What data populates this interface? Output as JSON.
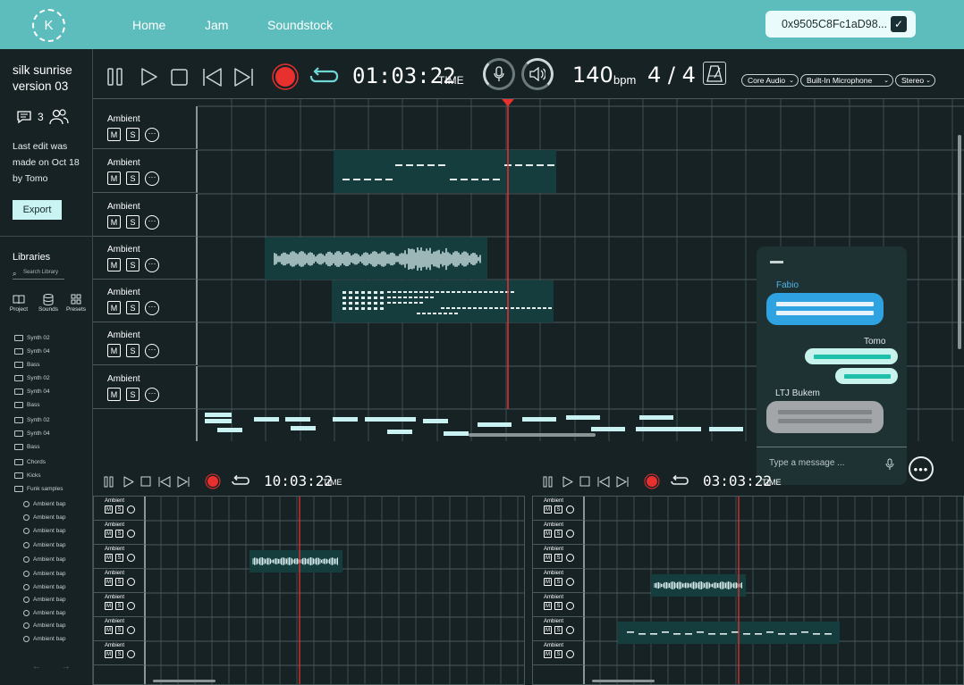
{
  "topbar": {
    "logo_letter": "K",
    "nav": [
      "Home",
      "Jam",
      "Soundstock"
    ],
    "wallet_address": "0x9505C8Fc1aD98..."
  },
  "project": {
    "title_line1": "silk sunrise",
    "title_line2": "version 03",
    "collaborators_count": "3",
    "last_edit": [
      "Last edit was",
      "made on Oct 18",
      "by Tomo"
    ],
    "export_label": "Export"
  },
  "libraries": {
    "title": "Libraries",
    "search_placeholder": "Search Library",
    "tabs": [
      "Project",
      "Sounds",
      "Presets"
    ],
    "tree": [
      {
        "label": "Synth 02",
        "type": "folder"
      },
      {
        "label": "Synth 04",
        "type": "folder"
      },
      {
        "label": "Bass",
        "type": "folder"
      },
      {
        "label": "Synth 02",
        "type": "folder"
      },
      {
        "label": "Synth 04",
        "type": "folder"
      },
      {
        "label": "Bass",
        "type": "folder"
      },
      {
        "label": "Synth 02",
        "type": "folder"
      },
      {
        "label": "Synth 04",
        "type": "folder"
      },
      {
        "label": "Bass",
        "type": "folder"
      },
      {
        "label": "Chords",
        "type": "folder"
      },
      {
        "label": "Kicks",
        "type": "folder"
      },
      {
        "label": "Funk samples",
        "type": "folder"
      },
      {
        "label": "Ambient bap",
        "type": "sound"
      },
      {
        "label": "Ambient bap",
        "type": "sound"
      },
      {
        "label": "Ambient bap",
        "type": "sound"
      },
      {
        "label": "Ambient bap",
        "type": "sound"
      },
      {
        "label": "Ambient bap",
        "type": "sound"
      },
      {
        "label": "Ambient bap",
        "type": "sound"
      },
      {
        "label": "Ambient bap",
        "type": "sound"
      },
      {
        "label": "Ambient bap",
        "type": "sound"
      },
      {
        "label": "Ambient bap",
        "type": "sound"
      },
      {
        "label": "Ambient bap",
        "type": "sound"
      },
      {
        "label": "Ambient bap",
        "type": "sound"
      }
    ],
    "pager": "← →"
  },
  "transport": {
    "time": "01:03:22",
    "time_label": "TIME",
    "bpm": "140",
    "bpm_label": "bpm",
    "signature": "4 / 4",
    "audio_driver": "Core Audio",
    "input_device": "Built-In Microphone",
    "channel_mode": "Stereo",
    "accent_record": "#e8302f",
    "accent_loop": "#6fd6d6"
  },
  "tracks": {
    "names": [
      "Ambient",
      "Ambient",
      "Ambient",
      "Ambient",
      "Ambient",
      "Ambient",
      "Ambient"
    ],
    "mute_label": "M",
    "solo_label": "S"
  },
  "chat": {
    "messages": [
      {
        "sender": "Fabio",
        "side": "left",
        "color": "#2fa3e2"
      },
      {
        "sender": "Tomo",
        "side": "right",
        "color": "#48d5c2"
      },
      {
        "sender": "LTJ Bukem",
        "side": "left",
        "color": "#a3a6a8"
      }
    ],
    "input_placeholder": "Type a message ..."
  },
  "mini_left": {
    "time": "10:03:22",
    "time_label": "TIME",
    "track_names": [
      "Ambient",
      "Ambient",
      "Ambient",
      "Ambient",
      "Ambient",
      "Ambient",
      "Ambient"
    ],
    "mute_label": "M",
    "solo_label": "S"
  },
  "mini_right": {
    "time": "03:03:22",
    "time_label": "TIME",
    "track_names": [
      "Ambient",
      "Ambient",
      "Ambient",
      "Ambient",
      "Ambient",
      "Ambient",
      "Ambient"
    ],
    "mute_label": "M",
    "solo_label": "S"
  }
}
